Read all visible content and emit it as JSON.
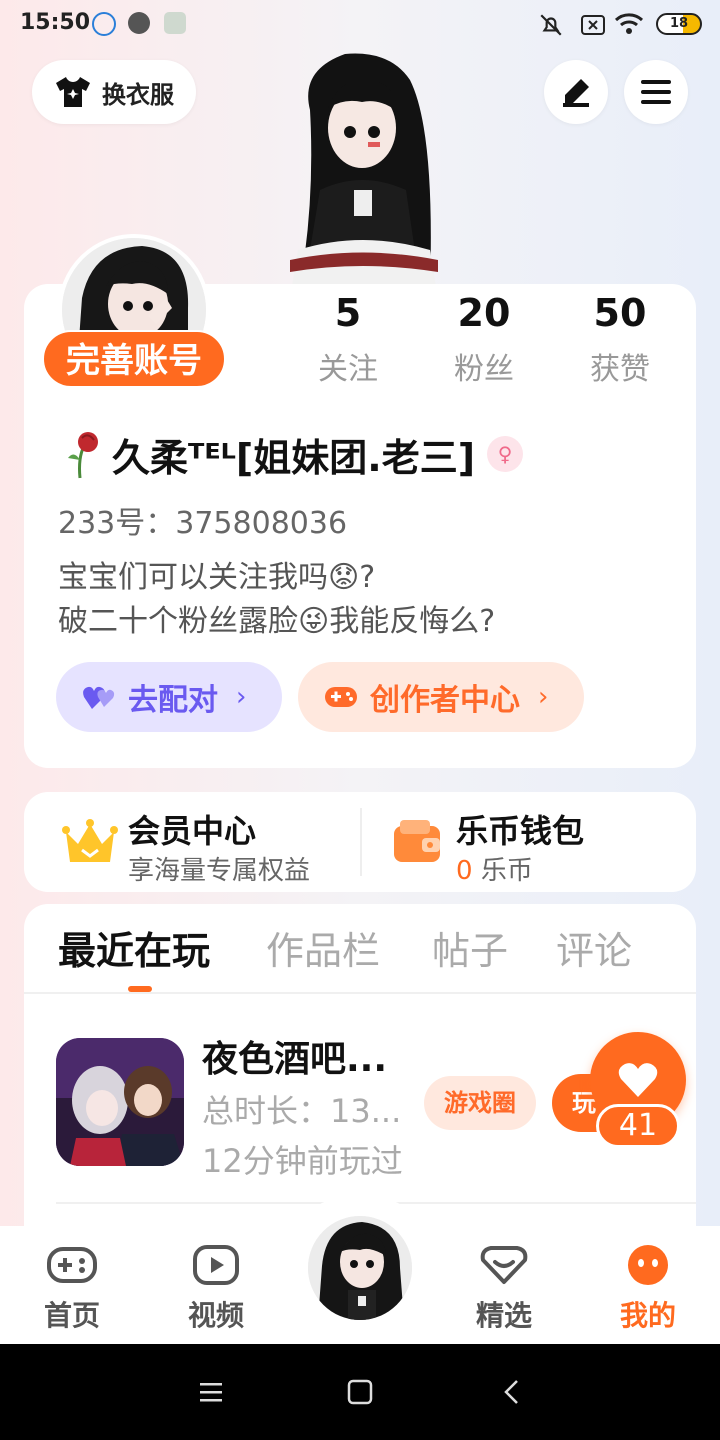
{
  "status_bar": {
    "time": "15:50",
    "battery": "18"
  },
  "header": {
    "dress_label": "换衣服"
  },
  "profile": {
    "complete_badge": "完善账号",
    "stats": [
      {
        "value": "5",
        "label": "关注"
      },
      {
        "value": "20",
        "label": "粉丝"
      },
      {
        "value": "50",
        "label": "获赞"
      }
    ],
    "username": "久柔ᵀᴱᴸ[姐妹团.老三]",
    "id_line": "233号：375808036",
    "bio_line1": "宝宝们可以关注我吗😟?",
    "bio_line2": "破二十个粉丝露脸😜我能反悔么?",
    "match_label": "去配对",
    "creator_label": "创作者中心"
  },
  "wallet": {
    "vip_title": "会员中心",
    "vip_sub": "享海量专属权益",
    "coin_title": "乐币钱包",
    "coin_amount": "0",
    "coin_unit": "乐币"
  },
  "tabs": [
    "最近在玩",
    "作品栏",
    "帖子",
    "评论"
  ],
  "recent_game": {
    "title": "夜色酒吧...",
    "duration": "总时长：13...",
    "last_played": "12分钟前玩过",
    "circle_label": "游戏圈",
    "play_label": "玩",
    "likes": "41"
  },
  "bottom_nav": [
    {
      "label": "首页"
    },
    {
      "label": "视频"
    },
    {
      "label": "精选"
    },
    {
      "label": "我的"
    }
  ],
  "colors": {
    "accent": "#ff6a1f",
    "match": "#6a5af0"
  }
}
